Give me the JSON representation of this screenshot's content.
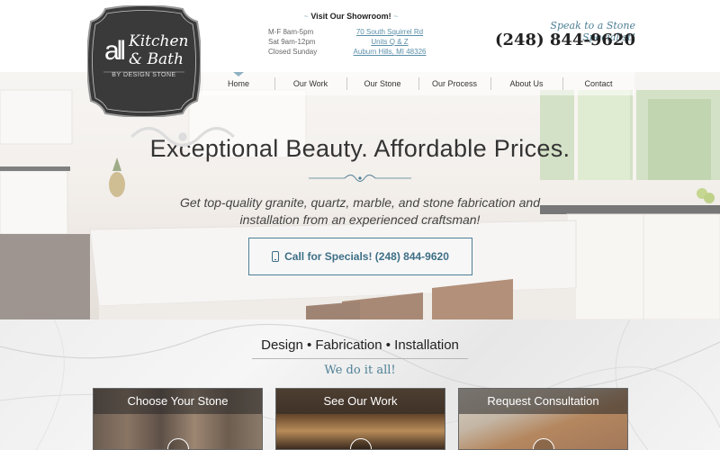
{
  "logo": {
    "all": "all",
    "kitchen": "Kitchen",
    "bath": "& Bath",
    "subtitle": "BY DESIGN STONE"
  },
  "showroom": {
    "title": "Visit Our Showroom!",
    "hours": [
      "M-F 8am-5pm",
      "Sat 9am-12pm",
      "Closed Sunday"
    ],
    "address": [
      "70 South Squirrel Rd",
      "Units Q & Z",
      "Auburn Hills, MI 48326"
    ]
  },
  "contact": {
    "speak_label": "Speak to a Stone Specialist!",
    "phone": "(248) 844-9620"
  },
  "nav": {
    "items": [
      {
        "label": "Home",
        "active": true
      },
      {
        "label": "Our Work",
        "active": false
      },
      {
        "label": "Our Stone",
        "active": false
      },
      {
        "label": "Our Process",
        "active": false
      },
      {
        "label": "About Us",
        "active": false
      },
      {
        "label": "Contact",
        "active": false
      }
    ]
  },
  "hero": {
    "headline": "Exceptional Beauty. Affordable Prices.",
    "subtext": "Get top-quality granite, quartz, marble, and stone fabrication and installation from an experienced craftsman!",
    "cta_label": "Call for Specials! (248) 844-9620"
  },
  "services": {
    "title": "Design • Fabrication • Installation",
    "subtitle": "We do it all!",
    "cards": [
      {
        "title": "Choose Your Stone"
      },
      {
        "title": "See Our Work"
      },
      {
        "title": "Request Consultation"
      }
    ]
  },
  "colors": {
    "accent": "#4d7f95",
    "nav_indicator": "#8fb2c3",
    "logo_bg": "#3a3a3a"
  }
}
